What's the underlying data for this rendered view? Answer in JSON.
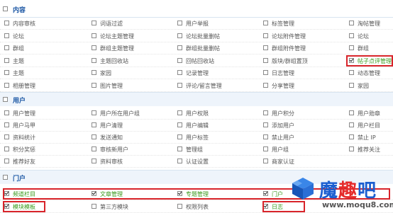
{
  "sections": {
    "content": {
      "title": "内容"
    },
    "user": {
      "title": "用户"
    },
    "portal": {
      "title": "门户"
    }
  },
  "content_rows": [
    [
      "内容审核",
      "词语过滤",
      "用户举报",
      "标签管理",
      "淘帖管理"
    ],
    [
      "论坛",
      "论坛主题管理",
      "论坛批量删帖",
      "论坛附件管理",
      "论坛"
    ],
    [
      "群组",
      "群组主题管理",
      "群组批量删帖",
      "群组附件管理",
      "群组"
    ],
    [
      "主题",
      "主题回收站",
      "回帖回收站",
      "版块/群组置顶",
      "帖子点评管理"
    ],
    [
      "主题",
      "家园",
      "记录管理",
      "日志管理",
      "动态管理"
    ],
    [
      "相册管理",
      "图片管理",
      "评论/留言管理",
      "分享管理",
      "家园"
    ]
  ],
  "user_rows": [
    [
      "用户管理",
      "用户所在用户组",
      "用户权限",
      "用户积分",
      "用户勋章"
    ],
    [
      "用户马甲",
      "用户清理",
      "用户编辑",
      "添加用户",
      "用户栏目"
    ],
    [
      "资料统计",
      "发送通知",
      "用户标签",
      "禁止用户",
      "禁止 IP"
    ],
    [
      "积分奖惩",
      "审核新用户",
      "管理组",
      "用户组",
      "推荐关注"
    ],
    [
      "推荐好友",
      "资料审核",
      "认证设置",
      "商家认证",
      ""
    ]
  ],
  "portal_rows": [
    [
      "频道栏目",
      "文章管理",
      "专题管理",
      "门户",
      ""
    ],
    [
      "模块模板",
      "第三方模块",
      "权限列表",
      "日志",
      ""
    ]
  ],
  "checked": {
    "content_3_4": true,
    "portal_0_0": true,
    "portal_0_1": true,
    "portal_0_2": true,
    "portal_0_3": true,
    "portal_1_0": true,
    "portal_1_3": true
  },
  "watermark": {
    "brand_1": "魔",
    "brand_2": "趣",
    "brand_3": "吧",
    "url": "www.moqu8.com"
  },
  "colors": {
    "header_bg": "#eef4fb",
    "header_text": "#1a56a4",
    "highlight": "#d8242a",
    "checked_text": "#3a9a1d"
  }
}
